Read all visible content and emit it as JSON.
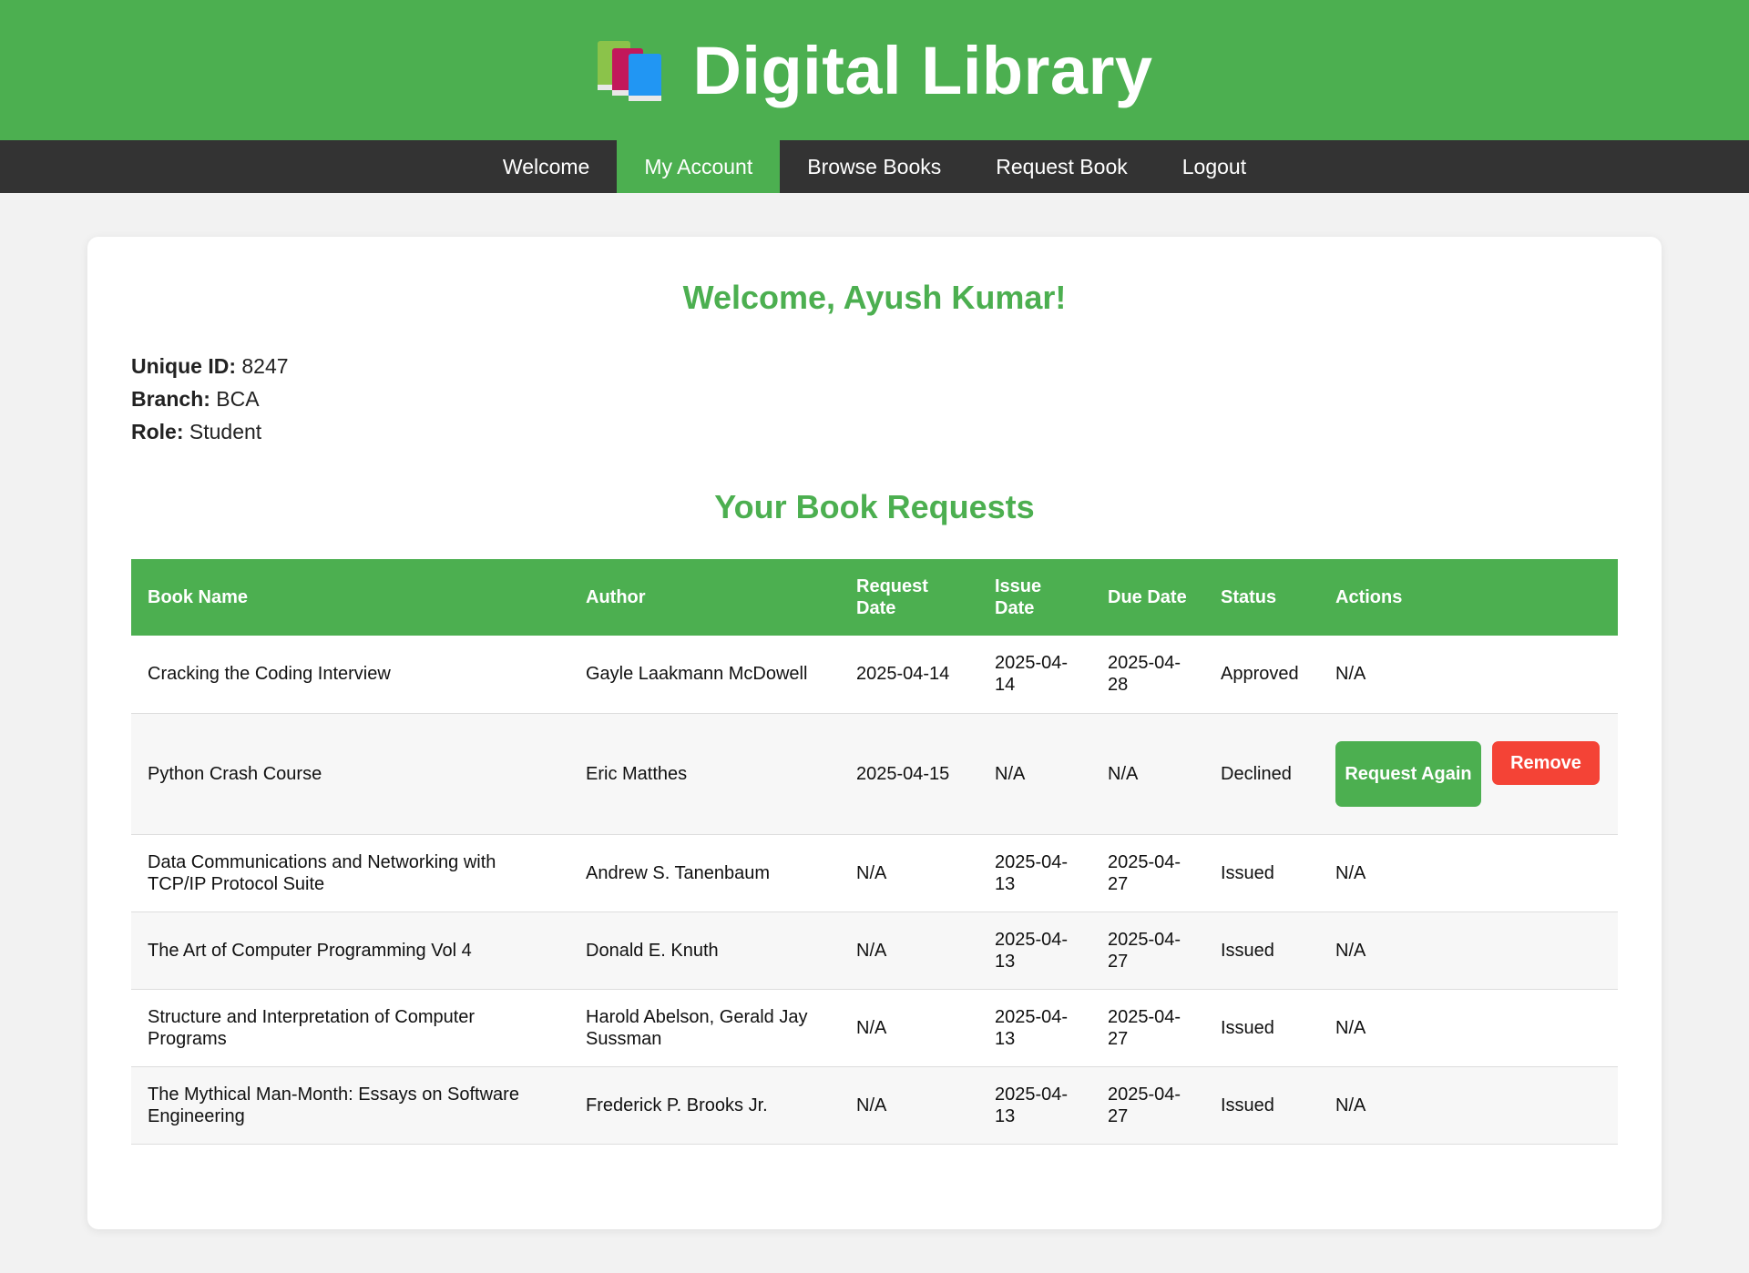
{
  "header": {
    "title": "Digital Library",
    "icon": "books-icon"
  },
  "nav": {
    "items": [
      {
        "label": "Welcome",
        "active": false
      },
      {
        "label": "My Account",
        "active": true
      },
      {
        "label": "Browse Books",
        "active": false
      },
      {
        "label": "Request Book",
        "active": false
      },
      {
        "label": "Logout",
        "active": false
      }
    ]
  },
  "account": {
    "welcome": "Welcome, Ayush Kumar!",
    "unique_id_label": "Unique ID:",
    "unique_id": "8247",
    "branch_label": "Branch:",
    "branch": "BCA",
    "role_label": "Role:",
    "role": "Student"
  },
  "requests": {
    "title": "Your Book Requests",
    "columns": [
      "Book Name",
      "Author",
      "Request Date",
      "Issue Date",
      "Due Date",
      "Status",
      "Actions"
    ],
    "rows": [
      {
        "book": "Cracking the Coding Interview",
        "author": "Gayle Laakmann McDowell",
        "request_date": "2025-04-14",
        "issue_date": "2025-04-14",
        "due_date": "2025-04-28",
        "status": "Approved",
        "actions": "N/A"
      },
      {
        "book": "Python Crash Course",
        "author": "Eric Matthes",
        "request_date": "2025-04-15",
        "issue_date": "N/A",
        "due_date": "N/A",
        "status": "Declined",
        "request_again_label": "Request Again",
        "remove_label": "Remove"
      },
      {
        "book": "Data Communications and Networking with TCP/IP Protocol Suite",
        "author": "Andrew S. Tanenbaum",
        "request_date": "N/A",
        "issue_date": "2025-04-13",
        "due_date": "2025-04-27",
        "status": "Issued",
        "actions": "N/A"
      },
      {
        "book": "The Art of Computer Programming Vol 4",
        "author": "Donald E. Knuth",
        "request_date": "N/A",
        "issue_date": "2025-04-13",
        "due_date": "2025-04-27",
        "status": "Issued",
        "actions": "N/A"
      },
      {
        "book": "Structure and Interpretation of Computer Programs",
        "author": "Harold Abelson, Gerald Jay Sussman",
        "request_date": "N/A",
        "issue_date": "2025-04-13",
        "due_date": "2025-04-27",
        "status": "Issued",
        "actions": "N/A"
      },
      {
        "book": "The Mythical Man-Month: Essays on Software Engineering",
        "author": "Frederick P. Brooks Jr.",
        "request_date": "N/A",
        "issue_date": "2025-04-13",
        "due_date": "2025-04-27",
        "status": "Issued",
        "actions": "N/A"
      }
    ]
  },
  "colors": {
    "accent": "#4caf50",
    "nav_bg": "#333333",
    "danger": "#f44336"
  }
}
